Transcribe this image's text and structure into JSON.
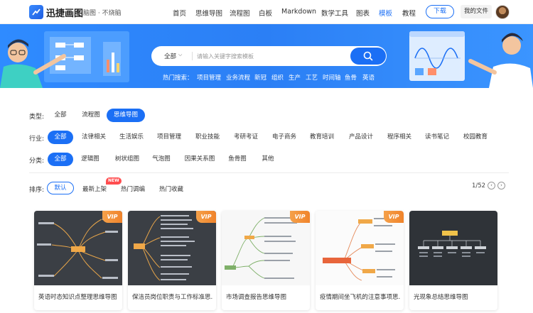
{
  "header": {
    "brand": "迅捷画图",
    "subtitle": "脑图 · 不烧脑",
    "nav": [
      {
        "label": "首页",
        "active": false
      },
      {
        "label": "思维导图",
        "active": false
      },
      {
        "label": "流程图",
        "active": false
      },
      {
        "label": "白板",
        "active": false
      },
      {
        "label": "Markdown",
        "active": false
      },
      {
        "label": "数学工具",
        "active": false
      },
      {
        "label": "图表",
        "active": false
      },
      {
        "label": "模板",
        "active": true
      },
      {
        "label": "教程",
        "active": false
      }
    ],
    "download": "下载",
    "my_files": "我的文件"
  },
  "search": {
    "scope": "全部",
    "placeholder": "请输入关键字搜索模板",
    "hot_label": "热门搜索：",
    "hot": [
      "项目管理",
      "业务流程",
      "新冠",
      "组织",
      "生产",
      "工艺",
      "时间轴",
      "鱼骨",
      "英语"
    ]
  },
  "filters": {
    "type": {
      "label": "类型:",
      "items": [
        "全部",
        "流程图",
        "思维导图"
      ],
      "selected": "思维导图"
    },
    "industry": {
      "label": "行业:",
      "items": [
        "全部",
        "法律相关",
        "生活娱乐",
        "项目管理",
        "职业技能",
        "考研考证",
        "电子商务",
        "教育培训",
        "产品设计",
        "程序相关",
        "读书笔记",
        "校园教育"
      ],
      "selected": "全部"
    },
    "category": {
      "label": "分类:",
      "items": [
        "全部",
        "逻辑图",
        "树状组图",
        "气泡图",
        "因果关系图",
        "鱼骨图",
        "其他"
      ],
      "selected": "全部"
    }
  },
  "sort": {
    "label": "排序:",
    "items": [
      "默认",
      "最新上架",
      "热门调编",
      "热门收藏"
    ],
    "selected": "默认",
    "new_badge": "NEW",
    "page": "1/52"
  },
  "cards": [
    {
      "title": "英语时态知识点整理思维导图",
      "vip": true,
      "vip_label": "VIP",
      "theme": "dark"
    },
    {
      "title": "保洁员岗位职责与工作标准思...",
      "vip": true,
      "vip_label": "VIP",
      "theme": "dark"
    },
    {
      "title": "市场调查报告思维导图",
      "vip": true,
      "vip_label": "VIP",
      "theme": "light"
    },
    {
      "title": "疫情期间坐飞机的注意事项思...",
      "vip": true,
      "vip_label": "VIP",
      "theme": "light"
    },
    {
      "title": "光现象总结思维导图",
      "vip": false,
      "vip_label": "",
      "theme": "dark"
    }
  ]
}
